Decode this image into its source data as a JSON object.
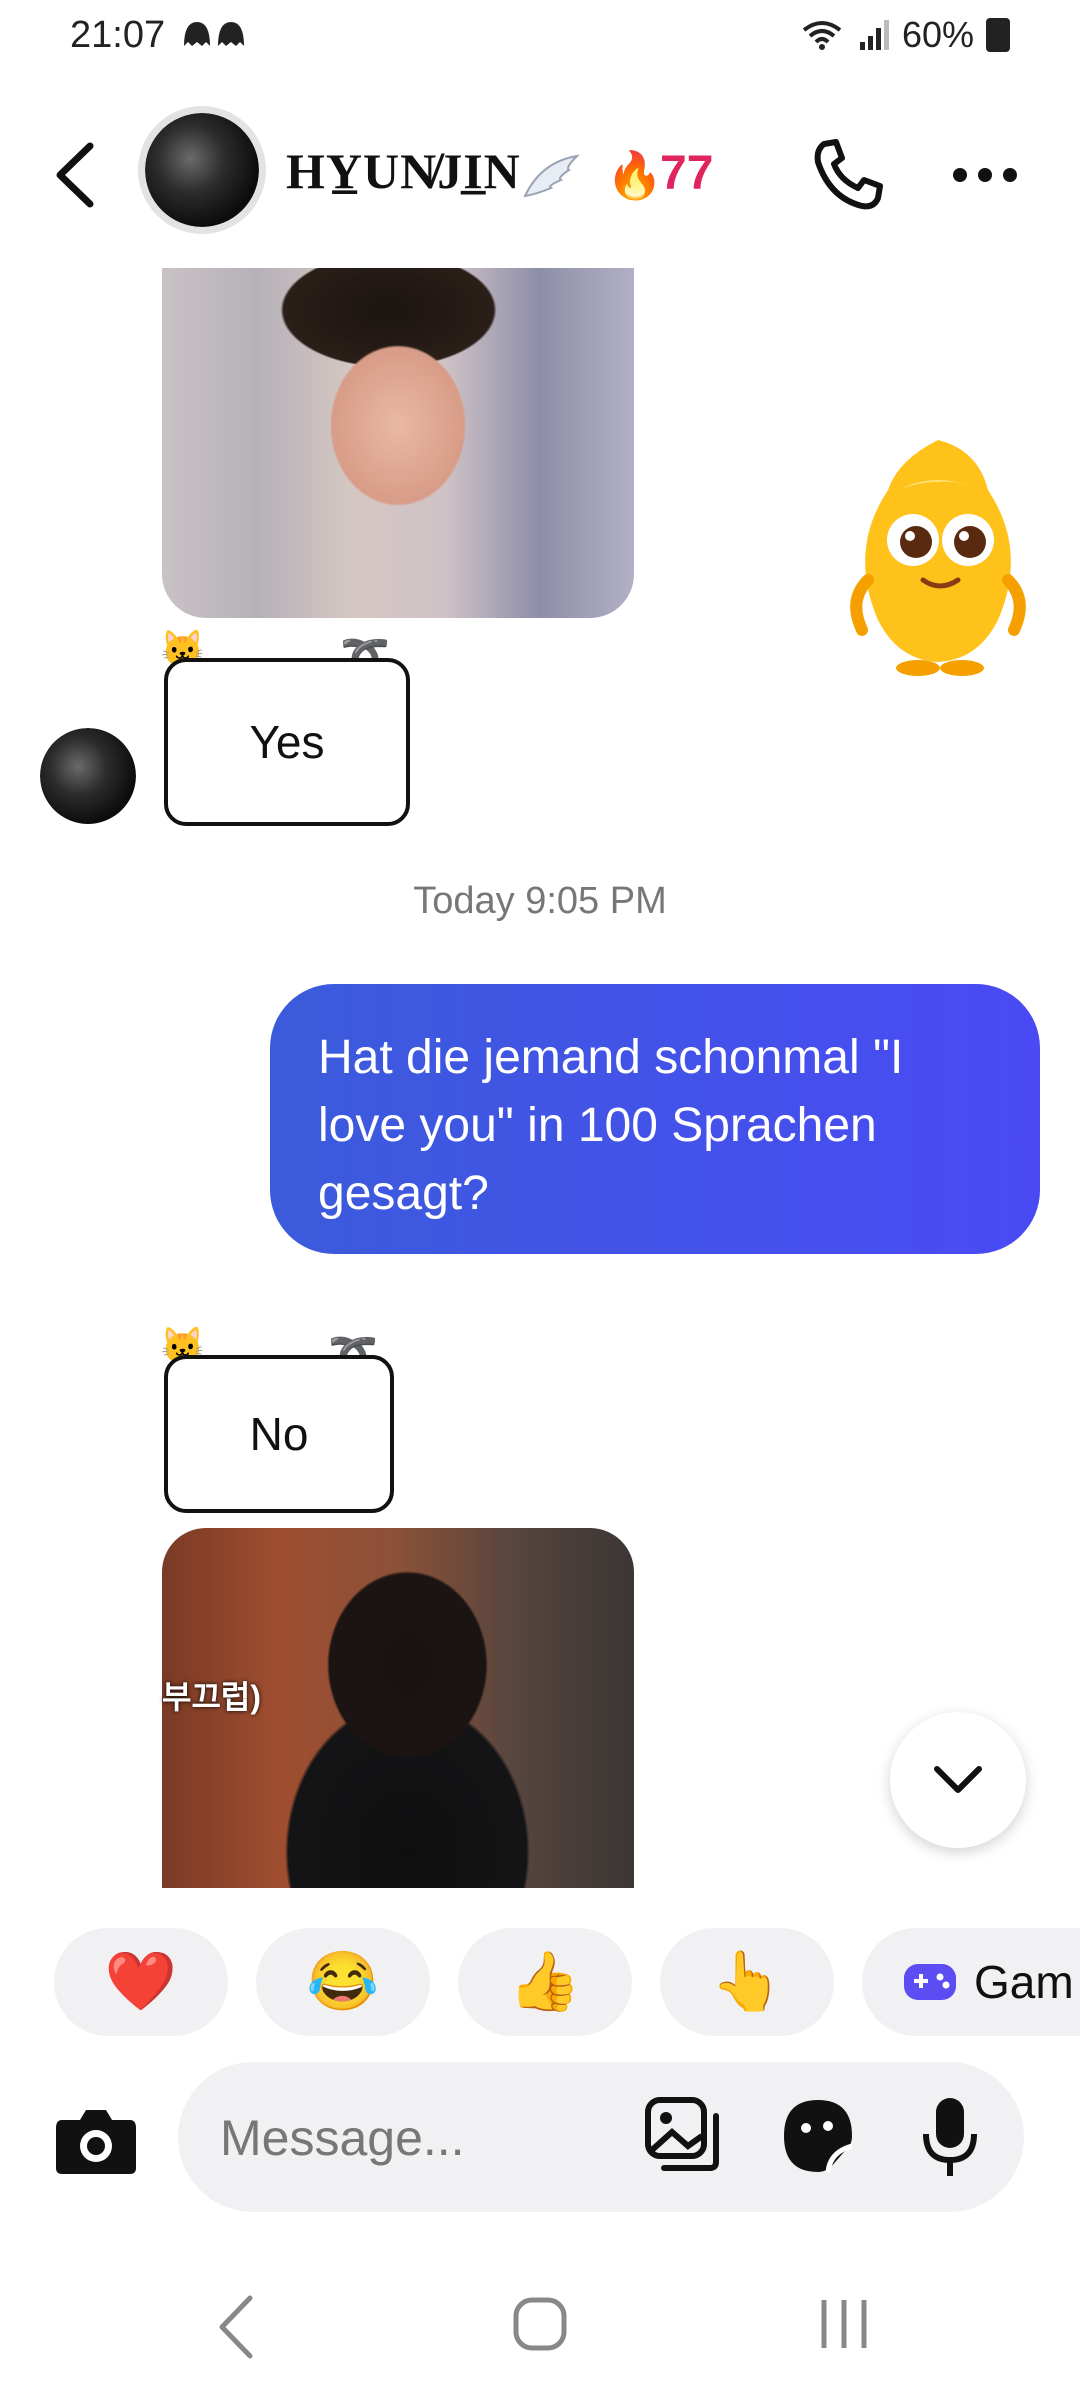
{
  "status_bar": {
    "time": "21:07",
    "notification_icons": "ghost-icon ghost-icon",
    "battery": "60%"
  },
  "header": {
    "contact_name": "HY̲UN̸JI̲N",
    "name_decoration": "wing-icon",
    "streak_icon": "fire-icon",
    "streak_count": "77"
  },
  "messages": {
    "sticker_yes": "Yes",
    "timestamp": "Today 9:05 PM",
    "my_message": "Hat die jemand schonmal \"I love you\" in 100 Sprachen gesagt?",
    "sticker_no": "No",
    "photo2_caption": "부끄럽)"
  },
  "quick_replies": [
    {
      "emoji": "❤️"
    },
    {
      "emoji": "😂"
    },
    {
      "emoji": "👍"
    },
    {
      "emoji": "👆"
    },
    {
      "label": "Gam"
    }
  ],
  "composer": {
    "placeholder": "Message..."
  },
  "colors": {
    "accent_blue": "#4a4af4",
    "streak_pink": "#e0245e",
    "pill_bg": "#f1f1f3"
  }
}
